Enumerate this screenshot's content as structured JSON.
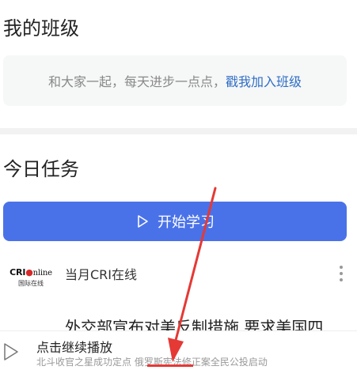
{
  "my_class": {
    "title": "我的班级",
    "prompt": "和大家一起，每天进步一点点，",
    "join_link": "戳我加入班级"
  },
  "today_tasks": {
    "title": "今日任务",
    "start_button": "开始学习"
  },
  "feed": {
    "logo_top_cri": "CRI",
    "logo_top_online": "nline",
    "logo_bottom": "国际在线",
    "source": "当月CRI在线",
    "headline": "外交部宣布对美反制措施 要求美国四"
  },
  "player": {
    "title": "点击继续播放",
    "subtitle": "北斗收官之星成功定点 俄罗斯宪法修正案全民公投启动"
  },
  "colors": {
    "accent": "#4a72e8",
    "link": "#2f6ec6",
    "annotation_red": "#e53935"
  },
  "icons": {
    "play": "play-outline-icon",
    "more": "more-vertical-icon"
  }
}
